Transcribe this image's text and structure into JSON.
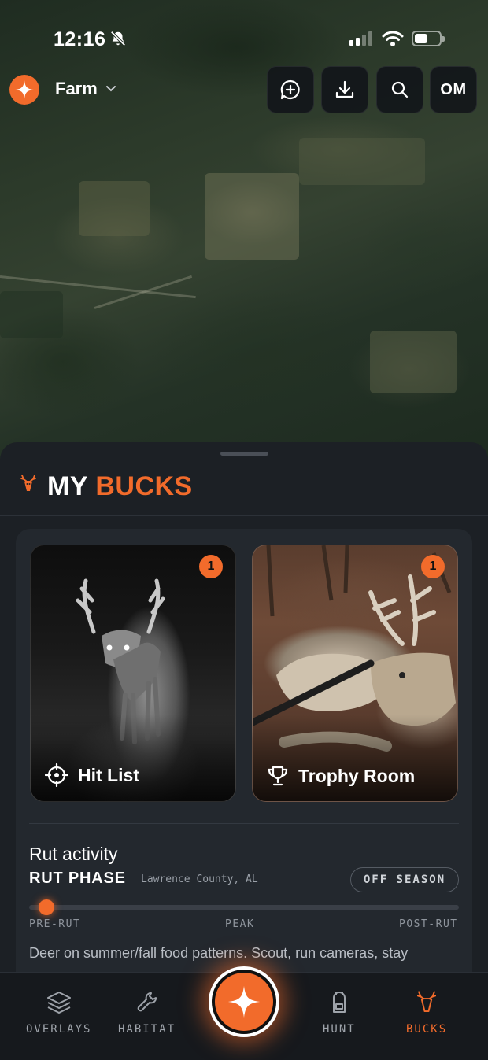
{
  "status_bar": {
    "time": "12:16"
  },
  "header": {
    "property_name": "Farm",
    "avatar_initials": "OM"
  },
  "sheet": {
    "title_part1": "MY",
    "title_part2": "BUCKS",
    "tiles": [
      {
        "label": "Hit List",
        "badge": "1"
      },
      {
        "label": "Trophy Room",
        "badge": "1"
      }
    ],
    "rut": {
      "title": "Rut activity",
      "phase_label": "RUT PHASE",
      "location": "Lawrence County, AL",
      "season_badge": "OFF SEASON",
      "slider_labels": [
        "PRE-RUT",
        "PEAK",
        "POST-RUT"
      ],
      "slider_position": 0.04,
      "description": "Deer on summer/fall food patterns. Scout, run cameras, stay"
    }
  },
  "tabbar": {
    "tabs": [
      {
        "label": "OVERLAYS",
        "icon": "layers-icon"
      },
      {
        "label": "HABITAT",
        "icon": "wrench-icon"
      },
      {
        "label": "HUNT",
        "icon": "backpack-icon"
      },
      {
        "label": "BUCKS",
        "icon": "deer-icon",
        "active": true
      }
    ]
  },
  "colors": {
    "accent": "#f26b2b",
    "sheet_bg": "#1c2025",
    "card_bg": "#23282e"
  }
}
